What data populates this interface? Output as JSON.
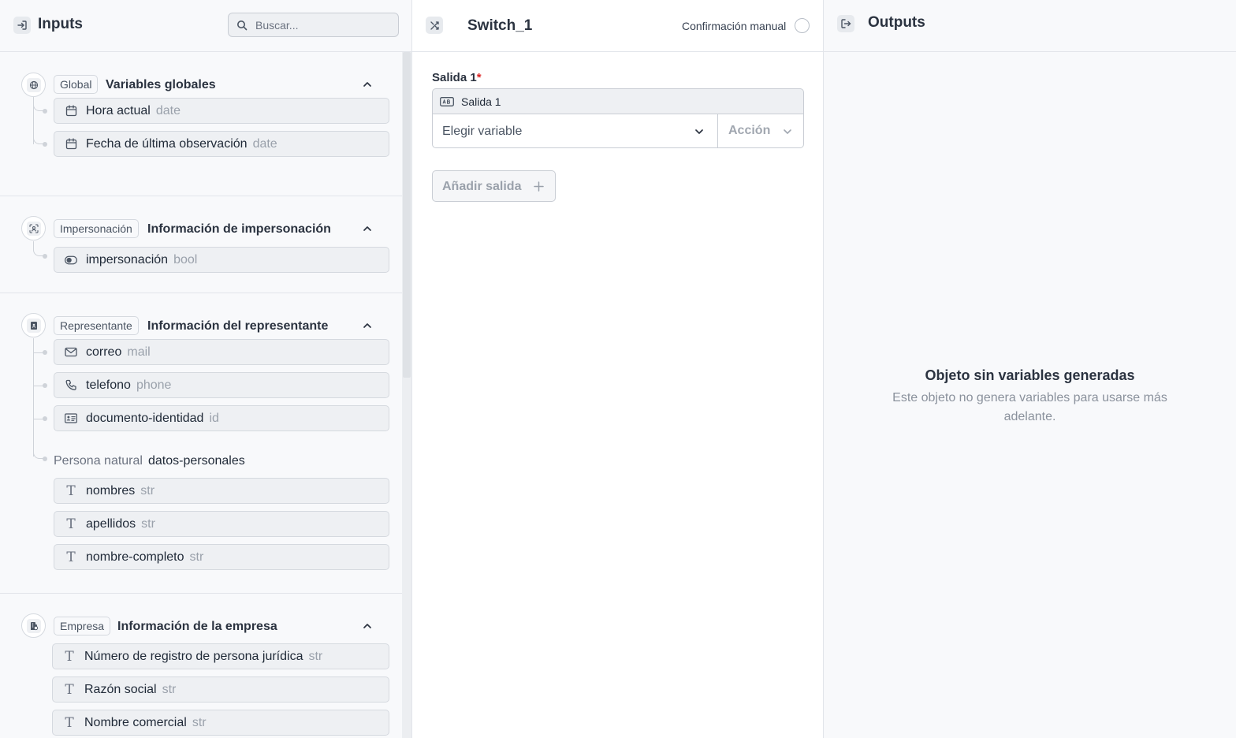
{
  "inputs": {
    "title": "Inputs",
    "search_placeholder": "Buscar...",
    "sections": [
      {
        "tag": "Global",
        "title": "Variables globales",
        "icon": "globe-icon",
        "items": [
          {
            "name": "Hora actual",
            "type": "date",
            "icon": "calendar-icon"
          },
          {
            "name": "Fecha de última observación",
            "type": "date",
            "icon": "calendar-icon"
          }
        ]
      },
      {
        "tag": "Impersonación",
        "title": "Información de impersonación",
        "icon": "face-scan-icon",
        "items": [
          {
            "name": "impersonación",
            "type": "bool",
            "icon": "toggle-icon"
          }
        ]
      },
      {
        "tag": "Representante",
        "title": "Información del representante",
        "icon": "badge-icon",
        "items": [
          {
            "name": "correo",
            "type": "mail",
            "icon": "mail-icon"
          },
          {
            "name": "telefono",
            "type": "phone",
            "icon": "phone-icon"
          },
          {
            "name": "documento-identidad",
            "type": "id",
            "icon": "id-card-icon"
          }
        ],
        "group": {
          "kind": "Persona natural",
          "name": "datos-personales",
          "items": [
            {
              "name": "nombres",
              "type": "str",
              "icon": "text-icon"
            },
            {
              "name": "apellidos",
              "type": "str",
              "icon": "text-icon"
            },
            {
              "name": "nombre-completo",
              "type": "str",
              "icon": "text-icon"
            }
          ]
        }
      },
      {
        "tag": "Empresa",
        "title": "Información de la empresa",
        "icon": "building-icon",
        "items": [
          {
            "name": "Número de registro de persona jurídica",
            "type": "str",
            "icon": "text-icon"
          },
          {
            "name": "Razón social",
            "type": "str",
            "icon": "text-icon"
          },
          {
            "name": "Nombre comercial",
            "type": "str",
            "icon": "text-icon"
          }
        ]
      }
    ]
  },
  "switch": {
    "title": "Switch_1",
    "manual_confirmation_label": "Confirmación manual",
    "manual_confirmation_on": false,
    "output_label": "Salida 1",
    "required_mark": "*",
    "output_name_value": "Salida 1",
    "choose_variable_placeholder": "Elegir variable",
    "action_label": "Acción",
    "add_output_label": "Añadir salida"
  },
  "outputs": {
    "title": "Outputs",
    "empty_title": "Objeto sin variables generadas",
    "empty_description": "Este objeto no genera variables para usarse más adelante."
  },
  "colors": {
    "accent_required": "#dc2626",
    "panel_bg": "#f8f9fb",
    "field_bg": "#eef0f3",
    "border": "#d5d9df"
  }
}
